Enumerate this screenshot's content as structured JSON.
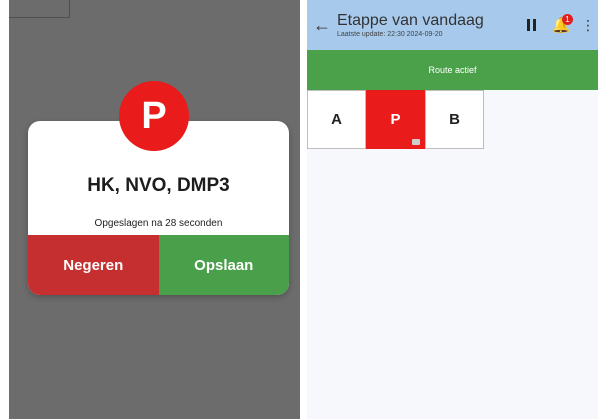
{
  "left": {
    "badge_letter": "P",
    "dialog_title": "HK, NVO, DMP3",
    "dialog_note": "Opgeslagen na 28 seconden",
    "ignore_label": "Negeren",
    "save_label": "Opslaan"
  },
  "right": {
    "title": "Etappe van vandaag",
    "subtitle": "Laatste update: 22:30 2024-09-20",
    "notification_count": "1",
    "route_status": "Route actief",
    "stops": [
      {
        "label": "A"
      },
      {
        "label": "P"
      },
      {
        "label": "B"
      }
    ]
  },
  "colors": {
    "overlay": "#6c6c6c",
    "red": "#ea1b1b",
    "green": "#4aa04a",
    "header_blue": "#a6c9ec"
  }
}
